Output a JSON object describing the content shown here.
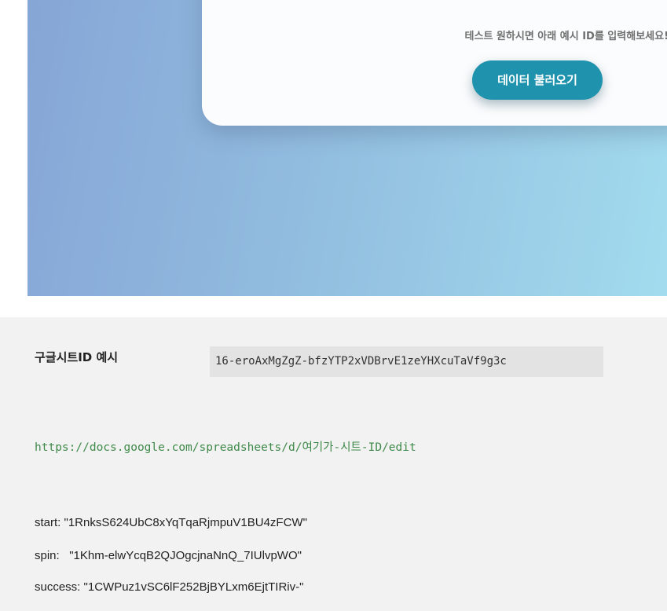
{
  "card": {
    "hint": "테스트 원하시면 아래 예시 ID를 입력해보세요!",
    "load_button": "데이터 불러오기"
  },
  "examples": {
    "label": "구글시트ID 예시",
    "sheet_id": "16-eroAxMgZgZ-bfzYTP2xVDBrvE1zeYHXcuTaVf9g3c",
    "url": "https://docs.google.com/spreadsheets/d/여기가-시트-ID/edit",
    "ids": [
      {
        "key": "start:",
        "value": "\"1RnksS624UbC8xYqTqaRjmpuV1BU4zFCW\""
      },
      {
        "key": "spin:  ",
        "value": "\"1Khm-elwYcqB2QJOgcjnaNnQ_7IUlvpWO\""
      },
      {
        "key": "success:",
        "value": "\"1CWPuz1vSC6lF252BjBYLxm6EjtTIRiv-\""
      }
    ]
  },
  "colors": {
    "gradient_start": "#86a6d6",
    "gradient_end": "#a2dbee",
    "button": "#1f93ad",
    "url_text": "#3f8a4a",
    "lower_bg": "#f2f2f2"
  }
}
